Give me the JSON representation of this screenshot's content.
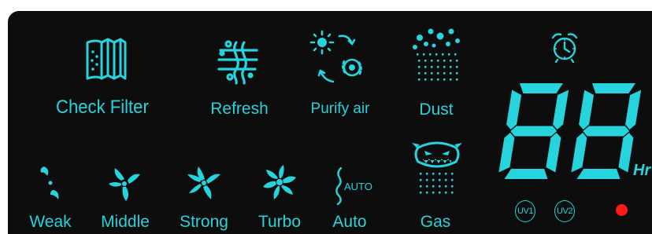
{
  "colors": {
    "accent": "#27d3dc",
    "background": "#0d0d0d",
    "alarm_led": "#ff1a1a"
  },
  "filter": {
    "label": "Check Filter",
    "icon": "filter-icon"
  },
  "refresh": {
    "label": "Refresh",
    "icon": "refresh-icon"
  },
  "purify": {
    "label": "Purify air",
    "icon": "purify-icon"
  },
  "dust": {
    "label": "Dust",
    "icon": "dust-icon"
  },
  "gas": {
    "label": "Gas",
    "icon": "gas-monster-icon"
  },
  "fan_speeds": {
    "weak": {
      "label": "Weak",
      "icon": "fan-weak-icon"
    },
    "middle": {
      "label": "Middle",
      "icon": "fan-middle-icon"
    },
    "strong": {
      "label": "Strong",
      "icon": "fan-strong-icon"
    },
    "turbo": {
      "label": "Turbo",
      "icon": "fan-turbo-icon"
    }
  },
  "auto": {
    "label": "Auto",
    "icon_text": "AUTO"
  },
  "timer": {
    "digits": "88",
    "unit": "Hr",
    "icon": "alarm-clock-icon"
  },
  "uv": {
    "uv1": "UV1",
    "uv2": "UV2"
  },
  "power_led": "red-indicator"
}
